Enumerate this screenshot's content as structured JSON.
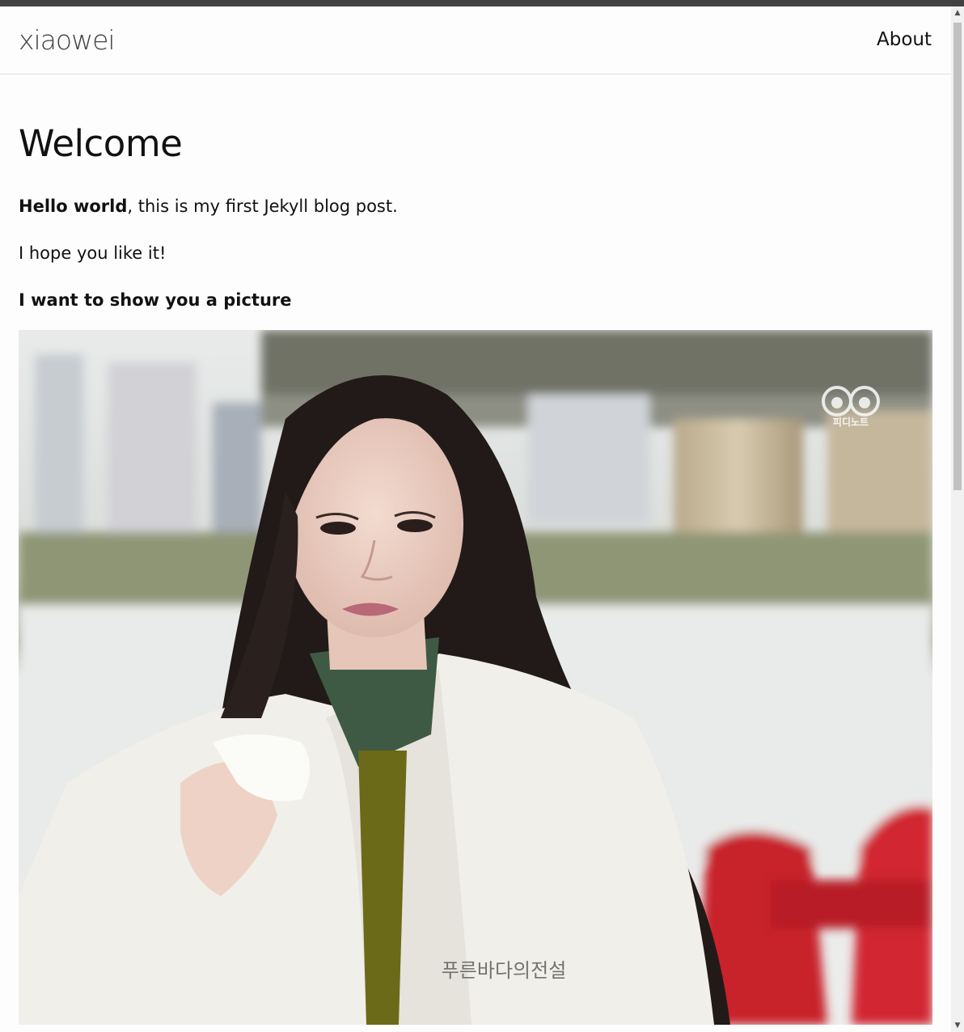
{
  "header": {
    "site_title": "xiaowei",
    "nav": [
      {
        "label": "About"
      }
    ]
  },
  "post": {
    "title": "Welcome",
    "intro_bold": "Hello world",
    "intro_rest": ", this is my first Jekyll blog post.",
    "line2": "I hope you like it!",
    "section_heading": "I want to show you a picture"
  },
  "image": {
    "watermark_top_right": "피디노트",
    "watermark_bottom": "푸른바다의전설"
  },
  "scrollbar": {
    "up_icon": "triangle-up",
    "down_icon": "triangle-down"
  }
}
